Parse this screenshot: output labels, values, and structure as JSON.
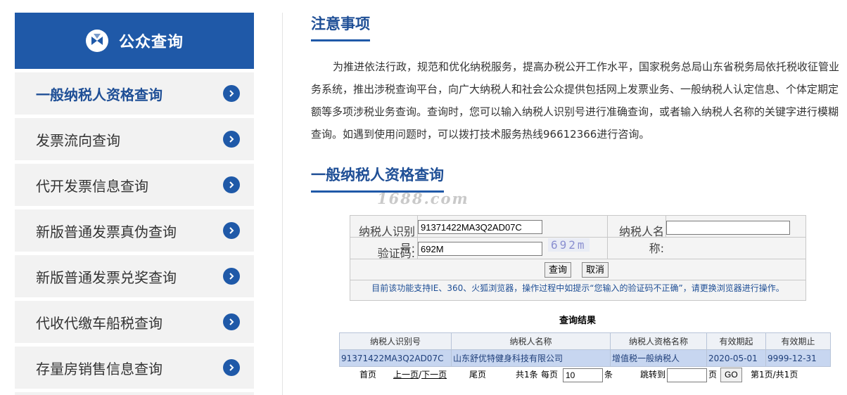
{
  "sidebar": {
    "header": "公众查询",
    "items": [
      {
        "label": "一般纳税人资格查询"
      },
      {
        "label": "发票流向查询"
      },
      {
        "label": "代开发票信息查询"
      },
      {
        "label": "新版普通发票真伪查询"
      },
      {
        "label": "新版普通发票兑奖查询"
      },
      {
        "label": "代收代缴车船税查询"
      },
      {
        "label": "存量房销售信息查询"
      }
    ]
  },
  "notice": {
    "title": "注意事项",
    "text": "为推进依法行政，规范和优化纳税服务，提高办税公开工作水平，国家税务总局山东省税务局依托税收征管业务系统，推出涉税查询平台，向广大纳税人和社会公众提供包括网上发票业务、一般纳税人认定信息、个体定期定额等多项涉税业务查询。查询时，您可以输入纳税人识别号进行准确查询，或者输入纳税人名称的关键字进行模糊查询。如遇到使用问题时，可以拨打技术服务热线96612366进行咨询。"
  },
  "query": {
    "title": "一般纳税人资格查询",
    "watermark": "1688.com",
    "taxpayer_id_label": "纳税人识别号:",
    "taxpayer_id_value": "91371422MA3Q2AD07C",
    "taxpayer_name_label": "纳税人名称:",
    "taxpayer_name_value": "",
    "captcha_label": "验证码:",
    "captcha_value": "692M",
    "captcha_image_text": "692m",
    "query_button": "查询",
    "cancel_button": "取消",
    "hint": "目前该功能支持IE、360、火狐浏览器，操作过程中如提示“您输入的验证码不正确”，请更换浏览器进行操作。"
  },
  "results": {
    "title": "查询结果",
    "columns": [
      "纳税人识别号",
      "纳税人名称",
      "纳税人资格名称",
      "有效期起",
      "有效期止"
    ],
    "rows": [
      [
        "91371422MA3Q2AD07C",
        "山东舒优特健身科技有限公司",
        "增值税一般纳税人",
        "2020-05-01",
        "9999-12-31"
      ]
    ]
  },
  "pager": {
    "first": "首页",
    "prev": "上一页",
    "sep": "/",
    "next": "下一页",
    "last": "尾页",
    "total": "共1条",
    "per_page_label": "每页",
    "per_page_value": "10",
    "per_page_unit": "条",
    "goto_label": "跳转到",
    "goto_value": "",
    "goto_unit": "页",
    "go_button": "GO",
    "status": "第1页/共1页"
  },
  "colors": {
    "brand_blue": "#1f59a8",
    "result_row": "#c7d6f0"
  }
}
